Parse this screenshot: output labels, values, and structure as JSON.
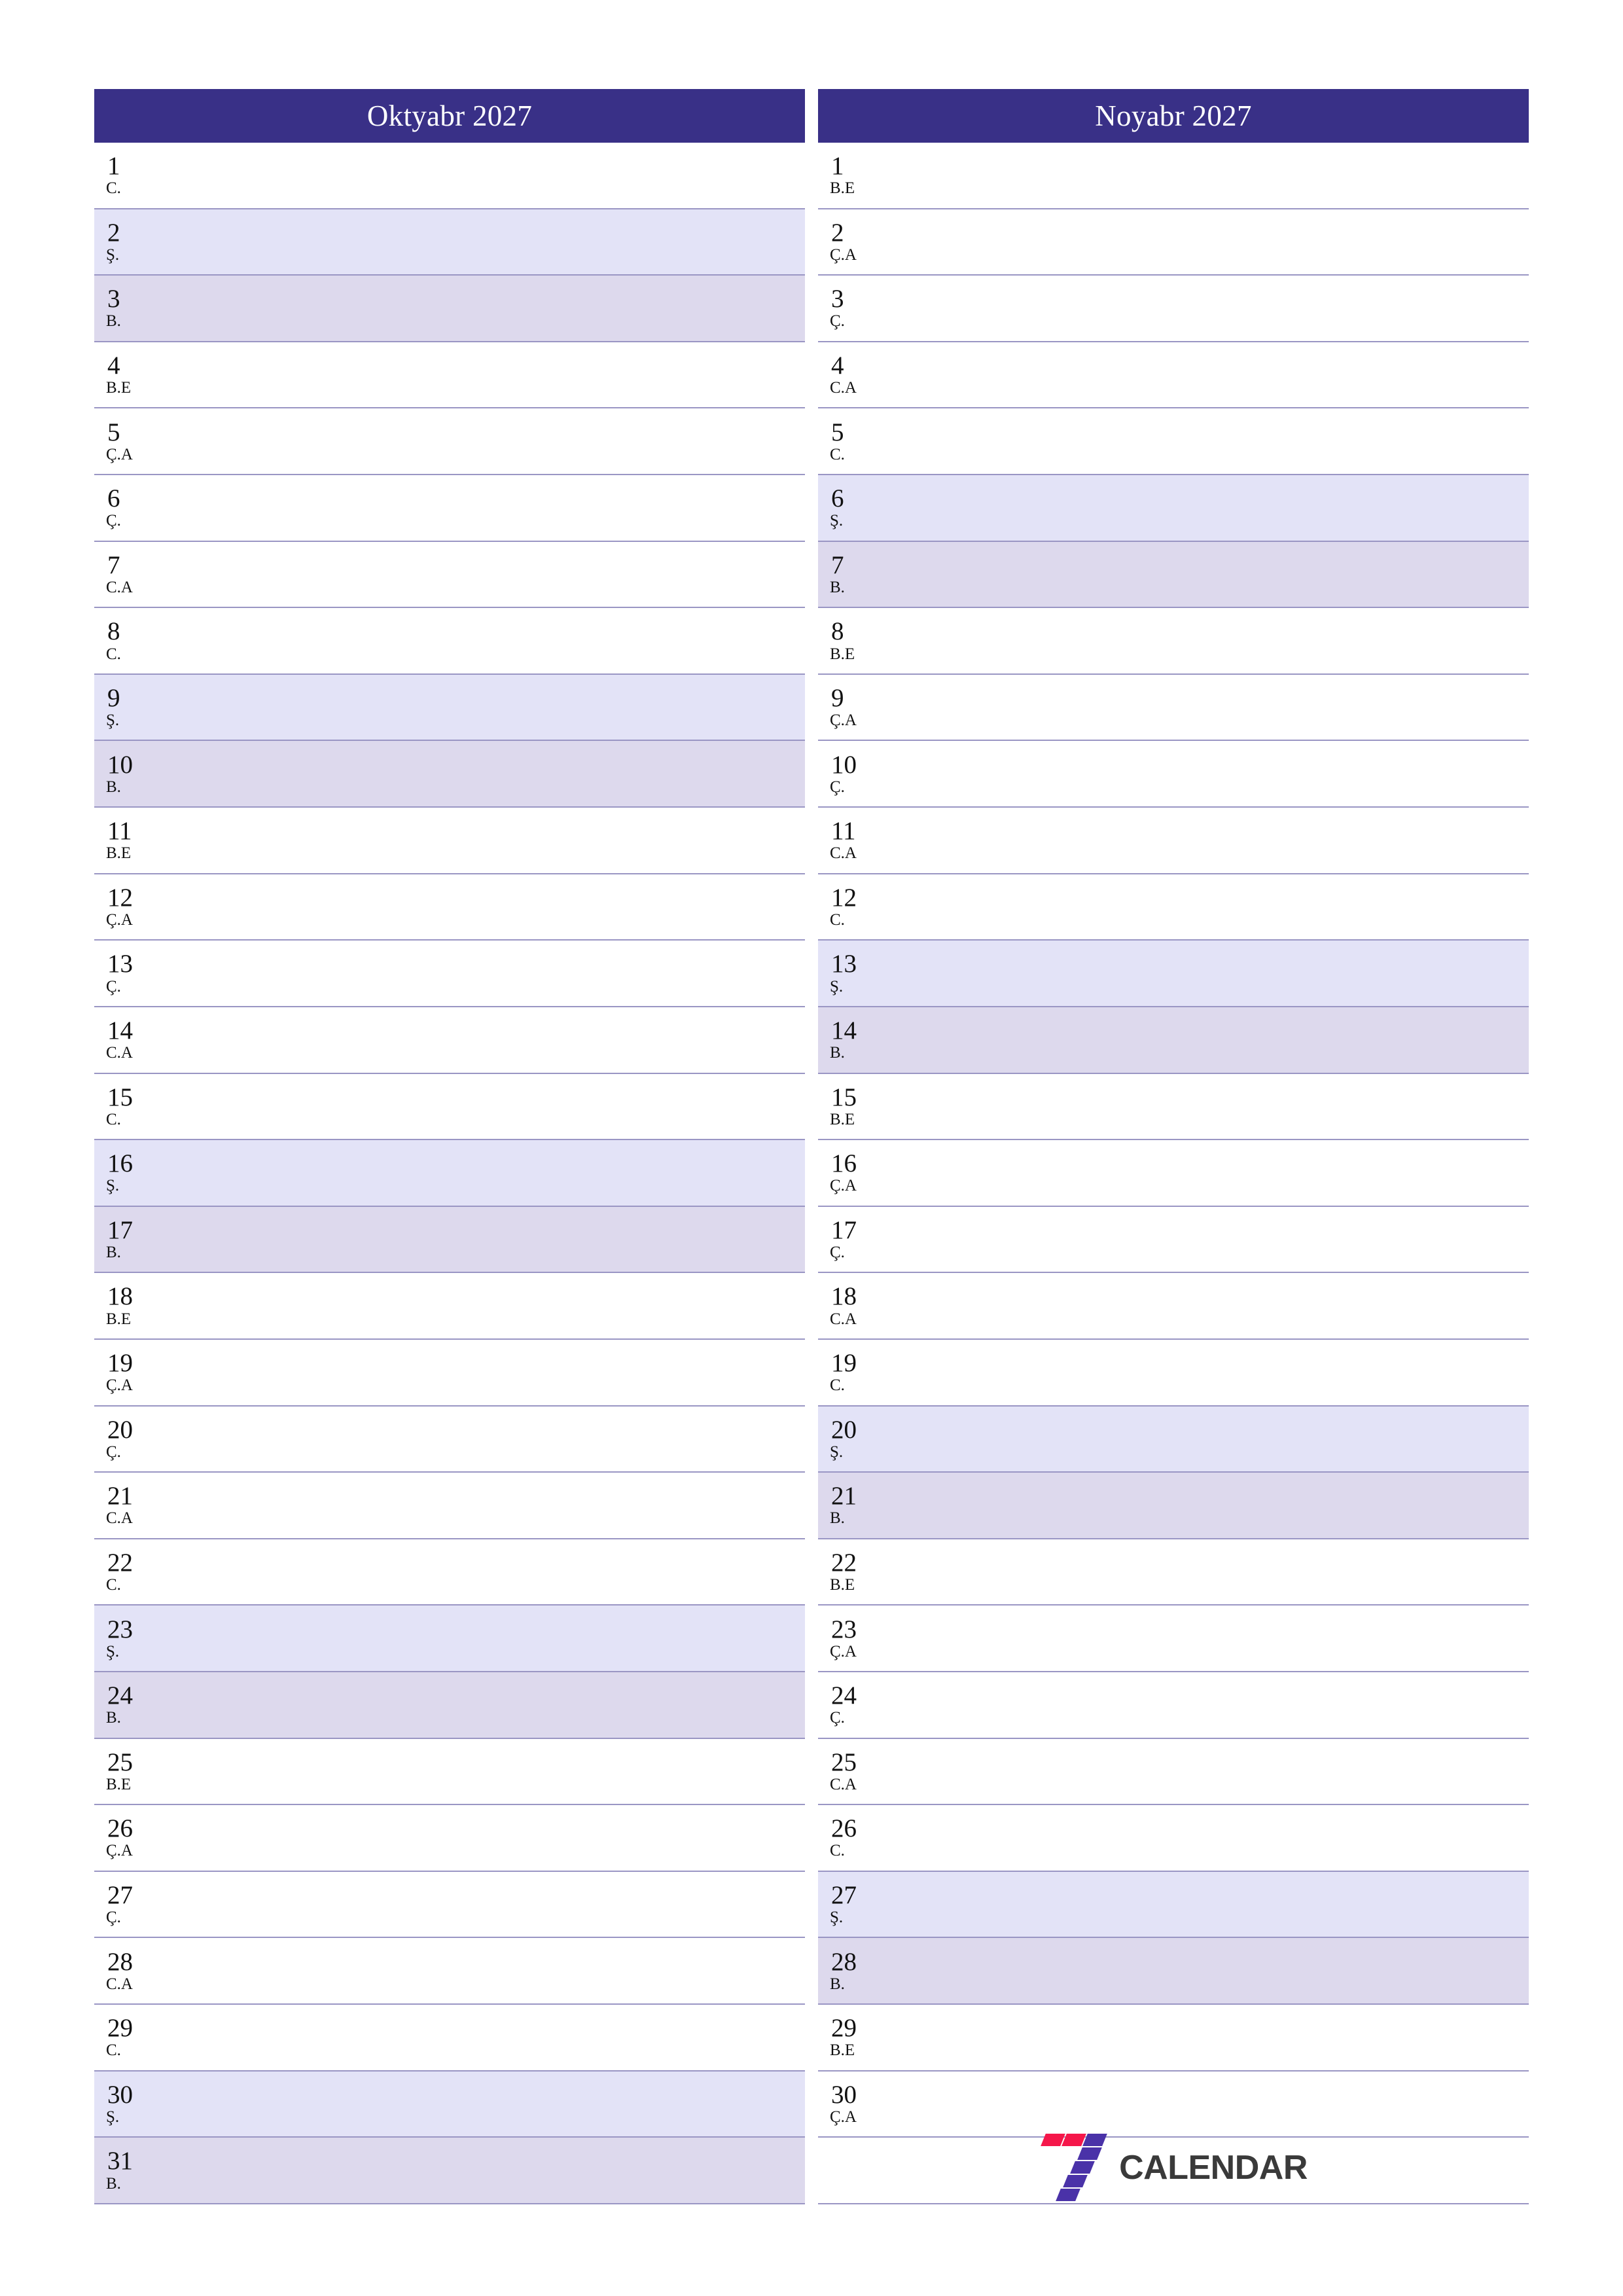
{
  "document": {
    "type": "two-month-planner",
    "year": "2027",
    "language": "az"
  },
  "colors": {
    "header_bg": "#393087",
    "header_text": "#ffffff",
    "saturday_bg": "#e3e3f7",
    "sunday_bg": "#ddd9ed",
    "grid_line": "#9a96c4",
    "logo_red": "#f5174a",
    "logo_purple": "#4a32a8",
    "logo_word": "#3a3a3a"
  },
  "weekday_codes": {
    "monday": "B.E",
    "tuesday": "Ç.A",
    "wednesday": "Ç.",
    "thursday": "C.A",
    "friday": "C.",
    "saturday": "Ş.",
    "sunday": "B."
  },
  "months": [
    {
      "title": "Oktyabr 2027",
      "days": [
        {
          "num": "1",
          "dow": "C.",
          "type": "weekday"
        },
        {
          "num": "2",
          "dow": "Ş.",
          "type": "sat"
        },
        {
          "num": "3",
          "dow": "B.",
          "type": "sun"
        },
        {
          "num": "4",
          "dow": "B.E",
          "type": "weekday"
        },
        {
          "num": "5",
          "dow": "Ç.A",
          "type": "weekday"
        },
        {
          "num": "6",
          "dow": "Ç.",
          "type": "weekday"
        },
        {
          "num": "7",
          "dow": "C.A",
          "type": "weekday"
        },
        {
          "num": "8",
          "dow": "C.",
          "type": "weekday"
        },
        {
          "num": "9",
          "dow": "Ş.",
          "type": "sat"
        },
        {
          "num": "10",
          "dow": "B.",
          "type": "sun"
        },
        {
          "num": "11",
          "dow": "B.E",
          "type": "weekday"
        },
        {
          "num": "12",
          "dow": "Ç.A",
          "type": "weekday"
        },
        {
          "num": "13",
          "dow": "Ç.",
          "type": "weekday"
        },
        {
          "num": "14",
          "dow": "C.A",
          "type": "weekday"
        },
        {
          "num": "15",
          "dow": "C.",
          "type": "weekday"
        },
        {
          "num": "16",
          "dow": "Ş.",
          "type": "sat"
        },
        {
          "num": "17",
          "dow": "B.",
          "type": "sun"
        },
        {
          "num": "18",
          "dow": "B.E",
          "type": "weekday"
        },
        {
          "num": "19",
          "dow": "Ç.A",
          "type": "weekday"
        },
        {
          "num": "20",
          "dow": "Ç.",
          "type": "weekday"
        },
        {
          "num": "21",
          "dow": "C.A",
          "type": "weekday"
        },
        {
          "num": "22",
          "dow": "C.",
          "type": "weekday"
        },
        {
          "num": "23",
          "dow": "Ş.",
          "type": "sat"
        },
        {
          "num": "24",
          "dow": "B.",
          "type": "sun"
        },
        {
          "num": "25",
          "dow": "B.E",
          "type": "weekday"
        },
        {
          "num": "26",
          "dow": "Ç.A",
          "type": "weekday"
        },
        {
          "num": "27",
          "dow": "Ç.",
          "type": "weekday"
        },
        {
          "num": "28",
          "dow": "C.A",
          "type": "weekday"
        },
        {
          "num": "29",
          "dow": "C.",
          "type": "weekday"
        },
        {
          "num": "30",
          "dow": "Ş.",
          "type": "sat"
        },
        {
          "num": "31",
          "dow": "B.",
          "type": "sun"
        }
      ]
    },
    {
      "title": "Noyabr 2027",
      "days": [
        {
          "num": "1",
          "dow": "B.E",
          "type": "weekday"
        },
        {
          "num": "2",
          "dow": "Ç.A",
          "type": "weekday"
        },
        {
          "num": "3",
          "dow": "Ç.",
          "type": "weekday"
        },
        {
          "num": "4",
          "dow": "C.A",
          "type": "weekday"
        },
        {
          "num": "5",
          "dow": "C.",
          "type": "weekday"
        },
        {
          "num": "6",
          "dow": "Ş.",
          "type": "sat"
        },
        {
          "num": "7",
          "dow": "B.",
          "type": "sun"
        },
        {
          "num": "8",
          "dow": "B.E",
          "type": "weekday"
        },
        {
          "num": "9",
          "dow": "Ç.A",
          "type": "weekday"
        },
        {
          "num": "10",
          "dow": "Ç.",
          "type": "weekday"
        },
        {
          "num": "11",
          "dow": "C.A",
          "type": "weekday"
        },
        {
          "num": "12",
          "dow": "C.",
          "type": "weekday"
        },
        {
          "num": "13",
          "dow": "Ş.",
          "type": "sat"
        },
        {
          "num": "14",
          "dow": "B.",
          "type": "sun"
        },
        {
          "num": "15",
          "dow": "B.E",
          "type": "weekday"
        },
        {
          "num": "16",
          "dow": "Ç.A",
          "type": "weekday"
        },
        {
          "num": "17",
          "dow": "Ç.",
          "type": "weekday"
        },
        {
          "num": "18",
          "dow": "C.A",
          "type": "weekday"
        },
        {
          "num": "19",
          "dow": "C.",
          "type": "weekday"
        },
        {
          "num": "20",
          "dow": "Ş.",
          "type": "sat"
        },
        {
          "num": "21",
          "dow": "B.",
          "type": "sun"
        },
        {
          "num": "22",
          "dow": "B.E",
          "type": "weekday"
        },
        {
          "num": "23",
          "dow": "Ç.A",
          "type": "weekday"
        },
        {
          "num": "24",
          "dow": "Ç.",
          "type": "weekday"
        },
        {
          "num": "25",
          "dow": "C.A",
          "type": "weekday"
        },
        {
          "num": "26",
          "dow": "C.",
          "type": "weekday"
        },
        {
          "num": "27",
          "dow": "Ş.",
          "type": "sat"
        },
        {
          "num": "28",
          "dow": "B.",
          "type": "sun"
        },
        {
          "num": "29",
          "dow": "B.E",
          "type": "weekday"
        },
        {
          "num": "30",
          "dow": "Ç.A",
          "type": "weekday"
        },
        {
          "num": "",
          "dow": "",
          "type": "logo"
        }
      ]
    }
  ],
  "branding": {
    "wordmark": "CALENDAR",
    "mark_name": "seven-logo"
  }
}
